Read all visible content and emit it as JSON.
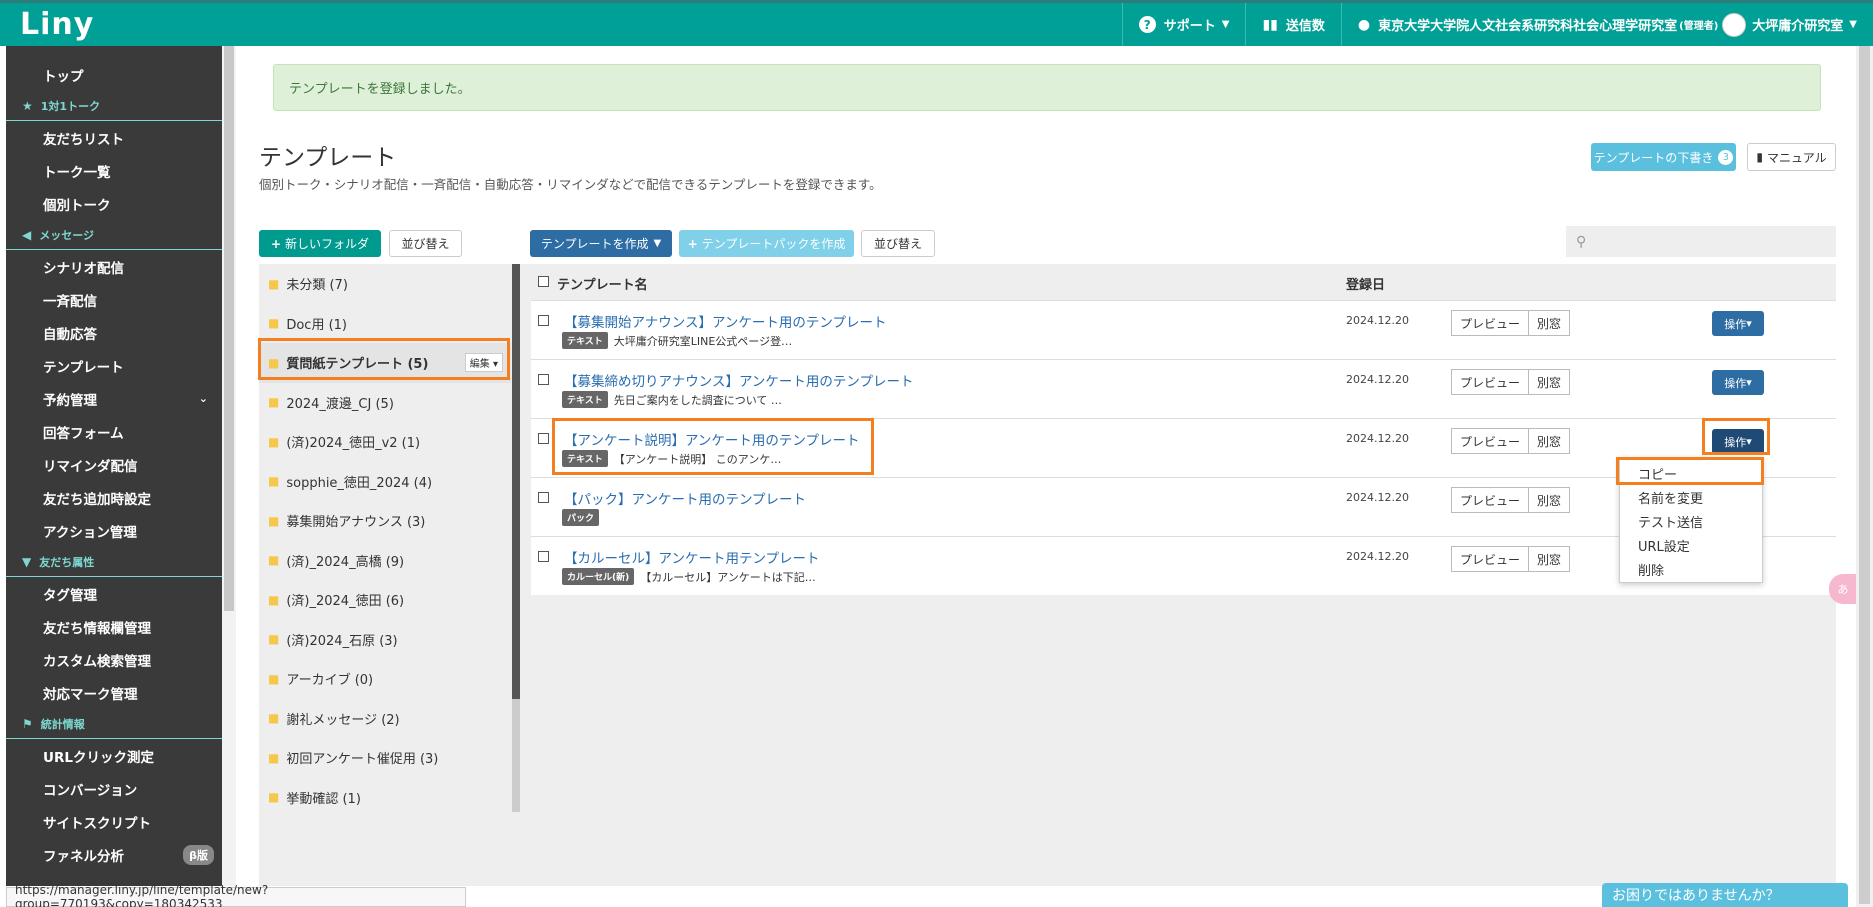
{
  "topbar": {
    "logo": "Liny",
    "support": "サポート",
    "send_count": "送信数",
    "account": "東京大学大学院人文社会系研究科社会心理学研究室",
    "account_role": "(管理者)",
    "lab": "大坪庸介研究室"
  },
  "sidebar": {
    "top": "トップ",
    "section_talk": "1対1トーク",
    "friends_list": "友だちリスト",
    "talk_list": "トーク一覧",
    "individual_talk": "個別トーク",
    "section_message": "メッセージ",
    "scenario": "シナリオ配信",
    "broadcast": "一斉配信",
    "auto_reply": "自動応答",
    "template": "テンプレート",
    "reservation": "予約管理",
    "answer_form": "回答フォーム",
    "reminder": "リマインダ配信",
    "friend_add": "友だち追加時設定",
    "action": "アクション管理",
    "section_attr": "友だち属性",
    "tags": "タグ管理",
    "friend_info": "友だち情報欄管理",
    "custom_search": "カスタム検索管理",
    "mark": "対応マーク管理",
    "section_stats": "統計情報",
    "url_click": "URLクリック測定",
    "conversion": "コンバージョン",
    "site_script": "サイトスクリプト",
    "funnel": "ファネル分析",
    "beta": "β版"
  },
  "alert": "テンプレートを登録しました。",
  "page": {
    "title": "テンプレート",
    "desc": "個別トーク・シナリオ配信・一斉配信・自動応答・リマインダなどで配信できるテンプレートを登録できます。",
    "draft_btn": "テンプレートの下書き",
    "draft_count": "3",
    "manual_btn": "マニュアル",
    "new_folder": "新しいフォルダ",
    "sort": "並び替え",
    "create": "テンプレートを作成",
    "create_pack": "テンプレートパックを作成",
    "sort2": "並び替え"
  },
  "folders": [
    {
      "label": "未分類 (7)"
    },
    {
      "label": "Doc用 (1)"
    },
    {
      "label": "質問紙テンプレート (5)",
      "edit": "編集"
    },
    {
      "label": "2024_渡邊_CJ (5)"
    },
    {
      "label": "(済)2024_徳田_v2 (1)"
    },
    {
      "label": "sopphie_徳田_2024 (4)"
    },
    {
      "label": "募集開始アナウンス (3)"
    },
    {
      "label": "(済)_2024_高橋 (9)"
    },
    {
      "label": "(済)_2024_徳田 (6)"
    },
    {
      "label": "(済)2024_石原 (3)"
    },
    {
      "label": "アーカイブ (0)"
    },
    {
      "label": "謝礼メッセージ (2)"
    },
    {
      "label": "初回アンケート催促用 (3)"
    },
    {
      "label": "挙動確認 (1)"
    }
  ],
  "table": {
    "col_name": "テンプレート名",
    "col_date": "登録日",
    "preview": "プレビュー",
    "newwin": "別窓",
    "operate": "操作",
    "rows": [
      {
        "name": "【募集開始アナウンス】アンケート用のテンプレート",
        "tag": "テキスト",
        "sub": "大坪庸介研究室LINE公式ページ登…",
        "date": "2024.12.20"
      },
      {
        "name": "【募集締め切りアナウンス】アンケート用のテンプレート",
        "tag": "テキスト",
        "sub": "先日ご案内をした調査について …",
        "date": "2024.12.20"
      },
      {
        "name": "【アンケート説明】アンケート用のテンプレート",
        "tag": "テキスト",
        "sub": "【アンケート説明】 このアンケ…",
        "date": "2024.12.20"
      },
      {
        "name": "【パック】アンケート用のテンプレート",
        "tag": "パック",
        "sub": "",
        "date": "2024.12.20"
      },
      {
        "name": "【カルーセル】アンケート用テンプレート",
        "tag": "カルーセル(新)",
        "sub": "【カルーセル】アンケートは下記…",
        "date": "2024.12.20"
      }
    ]
  },
  "dropdown": [
    "コピー",
    "名前を変更",
    "テスト送信",
    "URL設定",
    "削除"
  ],
  "status_url": "https://manager.liny.jp/line/template/new?group=770193&copy=180342533",
  "help": "お困りではありませんか？",
  "colors": {
    "brand": "#00a096",
    "highlight": "#f47f20",
    "primary": "#2d6da3"
  }
}
